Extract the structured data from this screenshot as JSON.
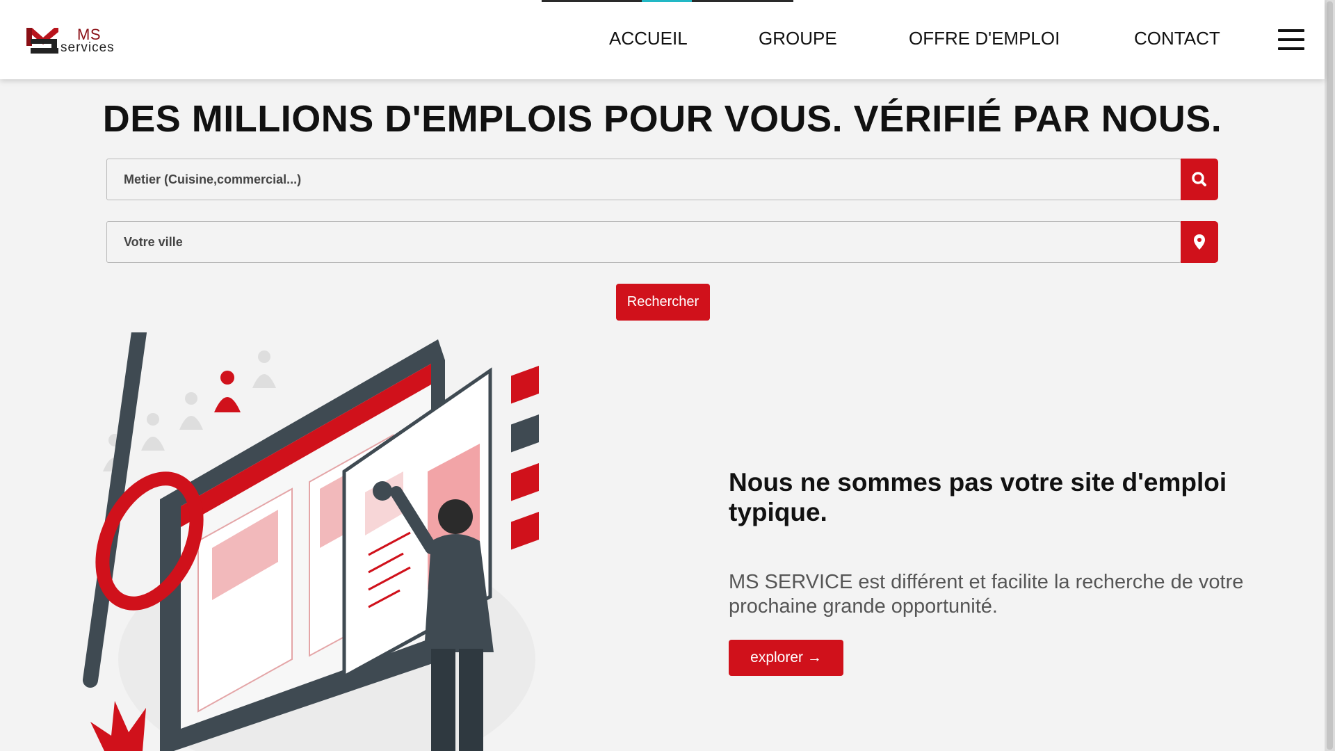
{
  "header": {
    "logo": {
      "ms": "MS",
      "services": "services"
    },
    "nav": [
      {
        "label": "ACCUEIL",
        "active": true
      },
      {
        "label": "GROUPE"
      },
      {
        "label": "OFFRE D'EMPLOI"
      },
      {
        "label": "CONTACT"
      }
    ],
    "menu_icon": "hamburger-menu-icon"
  },
  "hero": {
    "title": "DES MILLIONS D'EMPLOIS POUR VOUS. VÉRIFIÉ PAR NOUS.",
    "job_input": {
      "placeholder": "Metier (Cuisine,commercial...)",
      "value": "",
      "icon": "search-icon"
    },
    "city_input": {
      "placeholder": "Votre ville",
      "value": "",
      "icon": "map-pin-icon"
    },
    "search_button": "Rechercher"
  },
  "feature": {
    "tagline": "Nous ne sommes pas votre site d'emploi typique.",
    "description": "MS SERVICE est différent et facilite la recherche de votre prochaine grande opportunité.",
    "explore_button": "explorer →"
  },
  "colors": {
    "accent": "#d0111b",
    "brand_dark": "#8a0f15",
    "nav_indicator": "#22b8c5",
    "illustration_dark": "#3f4a52"
  }
}
